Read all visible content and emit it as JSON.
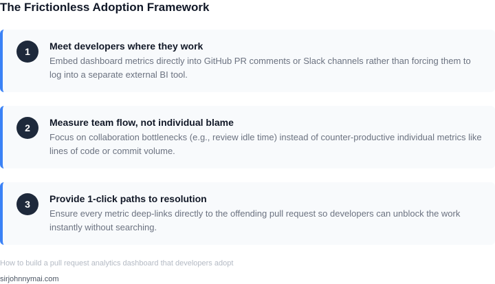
{
  "title": "The Frictionless Adoption Framework",
  "steps": [
    {
      "number": "1",
      "title": "Meet developers where they work",
      "description": "Embed dashboard metrics directly into GitHub PR comments or Slack channels rather than forcing them to log into a separate external BI tool."
    },
    {
      "number": "2",
      "title": "Measure team flow, not individual blame",
      "description": "Focus on collaboration bottlenecks (e.g., review idle time) instead of counter-productive individual metrics like lines of code or commit volume."
    },
    {
      "number": "3",
      "title": "Provide 1-click paths to resolution",
      "description": "Ensure every metric deep-links directly to the offending pull request so developers can unblock the work instantly without searching."
    }
  ],
  "footer": {
    "description": "How to build a pull request analytics dashboard that developers adopt",
    "site": "sirjohnnymai.com"
  },
  "colors": {
    "accent": "#3b82f6",
    "badge": "#1e293b",
    "card_background": "#f8fafc"
  }
}
